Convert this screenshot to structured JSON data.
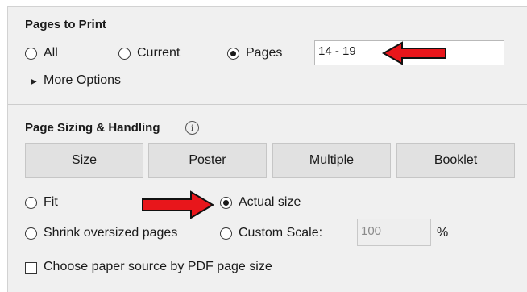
{
  "pages_to_print": {
    "heading": "Pages to Print",
    "options": {
      "all": "All",
      "current": "Current",
      "pages": "Pages"
    },
    "selected": "Pages",
    "pages_range_value": "14 - 19",
    "more_options_label": "More Options"
  },
  "page_sizing": {
    "heading": "Page Sizing & Handling",
    "info_icon_glyph": "i",
    "buttons": {
      "size": "Size",
      "poster": "Poster",
      "multiple": "Multiple",
      "booklet": "Booklet"
    },
    "options": {
      "fit": "Fit",
      "actual_size": "Actual size",
      "shrink": "Shrink oversized pages",
      "custom_scale": "Custom Scale:"
    },
    "selected": "Actual size",
    "custom_scale_value": "100",
    "percent_label": "%",
    "paper_source_label": "Choose paper source by PDF page size",
    "paper_source_checked": false
  },
  "colors": {
    "arrow_fill": "#e8161b",
    "arrow_outline": "#111111"
  },
  "icons": {
    "expand": "triangle-right-icon",
    "info": "info-circle-icon",
    "annotation": "red-arrow-icon"
  }
}
